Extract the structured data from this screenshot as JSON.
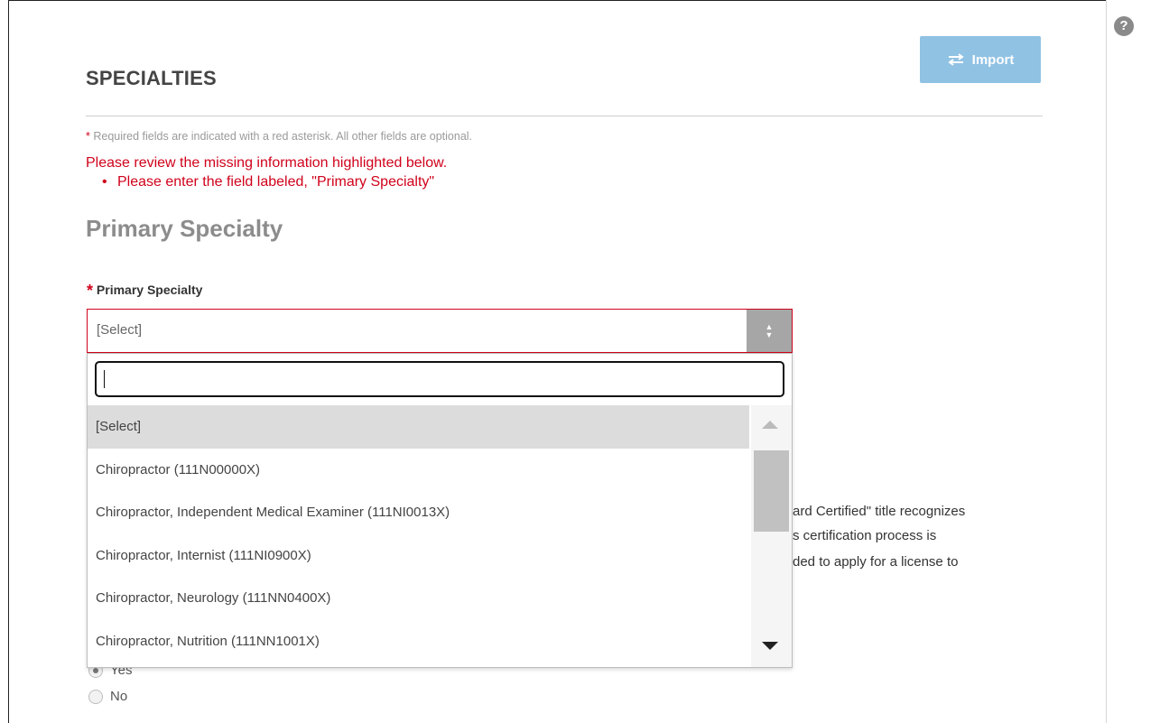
{
  "header": {
    "title": "SPECIALTIES",
    "import_label": "Import"
  },
  "notes": {
    "required_asterisk": "*",
    "required_text": "Required fields are indicated with a red asterisk. All other fields are optional.",
    "error_title": "Please review the missing information highlighted below.",
    "error_items": [
      "Please enter the field labeled, \"Primary Specialty\""
    ]
  },
  "primary": {
    "section_title": "Primary Specialty",
    "field_label": "Primary Specialty",
    "asterisk": "*",
    "selected_value": "[Select]",
    "search_value": "",
    "options": [
      "[Select]",
      "Chiropractor (111N00000X)",
      "Chiropractor, Independent Medical Examiner (111NI0013X)",
      "Chiropractor, Internist (111NI0900X)",
      "Chiropractor, Neurology (111NN0400X)",
      "Chiropractor, Nutrition (111NN1001X)"
    ]
  },
  "background_text": {
    "line1": "ard Certified\" title recognizes",
    "line2": "s certification process is",
    "line3": "ded to apply for a license to"
  },
  "radio": {
    "yes_label": "Yes",
    "no_label": "No",
    "selected": "Yes"
  },
  "colors": {
    "error": "#d0021b",
    "import_button": "#90c2e4",
    "select_arrow": "#a6a6a6"
  }
}
